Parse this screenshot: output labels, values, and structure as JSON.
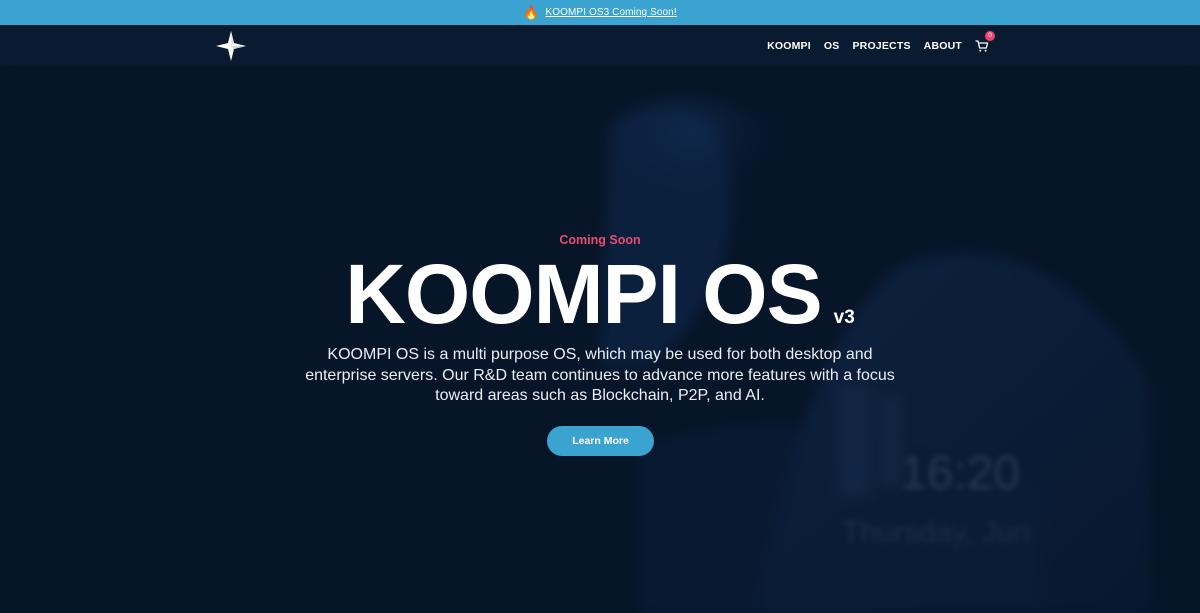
{
  "announcement": {
    "icon": "fire-icon",
    "text": "KOOMPI OS3 Coming Soon!"
  },
  "nav": {
    "logo": "koompi-star-logo",
    "links": [
      "KOOMPI",
      "OS",
      "PROJECTS",
      "ABOUT"
    ],
    "cart_count": "0"
  },
  "hero": {
    "eyebrow": "Coming Soon",
    "title": "KOOMPI OS",
    "version": "v3",
    "description": "KOOMPI OS is a multi purpose OS, which may be used for both desktop and enterprise servers. Our R&D team continues to advance more features with a focus toward areas such as Blockchain, P2P, and AI.",
    "cta_label": "Learn More",
    "background": {
      "clock": "16:20",
      "date": "Thursday, Jun"
    }
  },
  "colors": {
    "announce_bg": "#3ba3d0",
    "page_bg": "#08172d",
    "accent_pink": "#e94d6f",
    "button": "#3ba3d0"
  }
}
